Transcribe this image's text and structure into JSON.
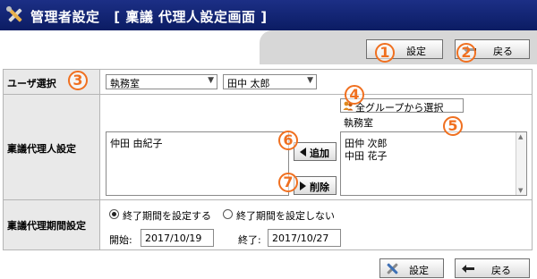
{
  "header": {
    "app_title": "管理者設定",
    "screen_title": "[ 稟議 代理人設定画面 ]"
  },
  "toolbar": {
    "settings_label": "設定",
    "back_label": "戻る"
  },
  "markers": [
    "1",
    "2",
    "3",
    "4",
    "5",
    "6",
    "7"
  ],
  "user_select": {
    "label": "ユーザ選択",
    "department": "執務室",
    "user": "田中 太郎"
  },
  "proxy": {
    "label": "稟議代理人設定",
    "selected": [
      "仲田 由紀子"
    ],
    "add_label": "追加",
    "delete_label": "削除",
    "select_all_groups_label": "全グループから選択",
    "group": "執務室",
    "candidates": [
      "田仲 次郎",
      "中田 花子"
    ]
  },
  "period": {
    "label": "稟議代理期間設定",
    "option_set": "終了期間を設定する",
    "option_unset": "終了期間を設定しない",
    "start_label": "開始:",
    "start_value": "2017/10/19",
    "end_label": "終了:",
    "end_value": "2017/10/27"
  },
  "footer": {
    "settings_label": "設定",
    "back_label": "戻る"
  },
  "colors": {
    "titlebar": "#0b1c63",
    "marker": "#f07020",
    "label_bg": "#e9e9e9"
  }
}
